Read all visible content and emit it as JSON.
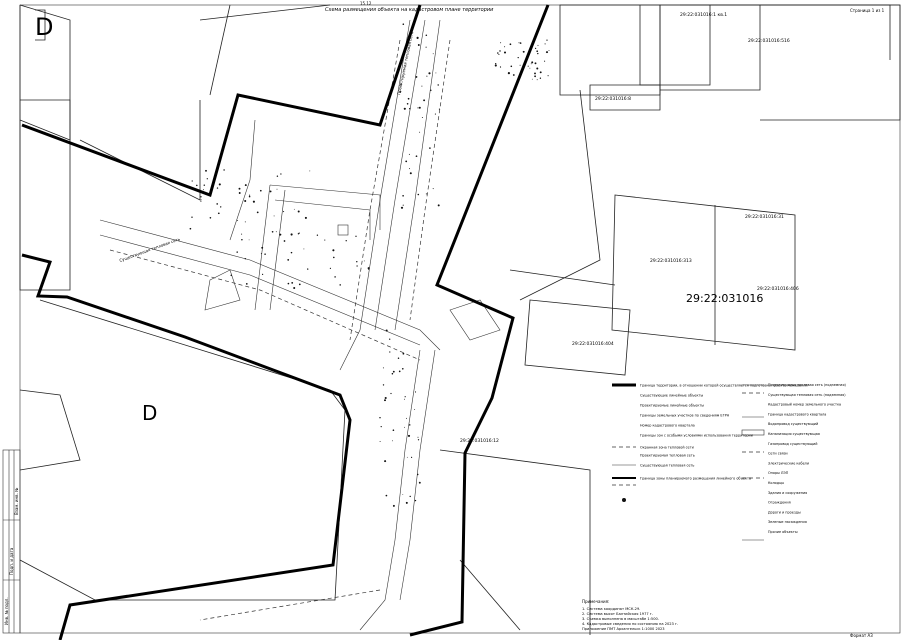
{
  "sheet": {
    "top_label": "Схема размещения объекта на кадастровом плане территории",
    "sheet_code": "15.12",
    "page_label": "Страница 1 из 1",
    "left_stamp": [
      "Инв. № подл.",
      "Подп. и дата",
      "Взам. инв. №"
    ],
    "bottom_right": "Формат А3"
  },
  "map": {
    "quarter_number": "29:22:031016",
    "parcels": [
      {
        "id": "p1",
        "label": "29:22:031016:1 кв.1"
      },
      {
        "id": "p2",
        "label": "29:22:031016:516"
      },
      {
        "id": "p3",
        "label": "29:22:031016:8"
      },
      {
        "id": "p4",
        "label": "29:22:031016:313"
      },
      {
        "id": "p5",
        "label": "29:22:031016:31"
      },
      {
        "id": "p6",
        "label": "29:22:031016:406"
      },
      {
        "id": "p7",
        "label": "29:22:031016:404"
      },
      {
        "id": "p8",
        "label": "29:22:031016:12"
      }
    ],
    "zone_letters": [
      "D",
      "D"
    ],
    "network_labels": [
      "Проектируемая тепловая сеть",
      "Существующая тепловая сеть"
    ]
  },
  "legend": {
    "left": [
      "Граница территории, в отношении которой осуществляется подготовка проекта межевания",
      "Существующие линейные объекты",
      "Проектируемые линейные объекты",
      "Границы земельных участков по сведениям ЕГРН",
      "Номер кадастрового квартала",
      "Границы зон с особыми условиями использования территории",
      "Охранная зона тепловой сети",
      "Проектируемая тепловая сеть",
      "Существующая тепловая сеть",
      "Граница зоны планируемого размещения линейного объекта"
    ],
    "right": [
      "Проектируемая тепловая сеть (подземная)",
      "Существующая тепловая сеть (надземная)",
      "Кадастровый номер земельного участка",
      "Граница кадастрового квартала",
      "Водопровод существующий",
      "Канализация существующая",
      "Газопровод существующий",
      "Сети связи",
      "Электрические кабели",
      "Опоры ЛЭП",
      "Колодцы",
      "Здания и сооружения",
      "Ограждения",
      "Дороги и проезды",
      "Зеленые насаждения",
      "Прочие объекты"
    ]
  },
  "notes": {
    "title": "Примечания:",
    "lines": [
      "1. Система координат МСК-29.",
      "2. Система высот Балтийская 1977 г.",
      "3. Съемка выполнена в масштабе 1:500.",
      "4. Кадастровые сведения по состоянию на 2023 г.",
      "Приложение ПМТ Архангельск 1:1000 2023"
    ]
  }
}
